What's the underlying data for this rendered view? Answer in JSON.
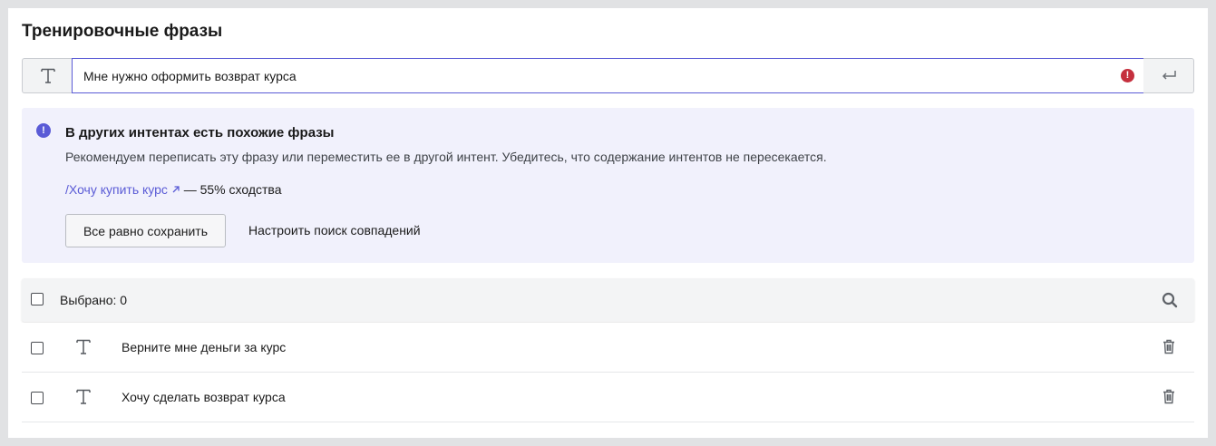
{
  "section": {
    "title": "Тренировочные фразы"
  },
  "input": {
    "value": "Мне нужно оформить возврат курса"
  },
  "warning": {
    "title": "В других интентах есть похожие фразы",
    "text": "Рекомендуем переписать эту фразу или переместить ее в другой интент. Убедитесь, что содержание интентов не пересекается.",
    "similar_link": "/Хочу купить курс",
    "similar_suffix": "— 55% сходства",
    "save_anyway_label": "Все равно сохранить",
    "configure_label": "Настроить поиск совпадений"
  },
  "list": {
    "selected_label": "Выбрано: 0",
    "rows": [
      {
        "text": "Верните мне деньги за курс"
      },
      {
        "text": "Хочу сделать возврат курса"
      }
    ]
  },
  "icons": {
    "type": "text-type-icon",
    "error": "error-icon",
    "enter": "enter-icon",
    "info": "info-icon",
    "external": "external-link-icon",
    "search": "search-icon",
    "delete": "trash-icon"
  },
  "colors": {
    "accent": "#5a5bd6",
    "error": "#c5303e",
    "warning_bg": "#f1f1fc"
  }
}
